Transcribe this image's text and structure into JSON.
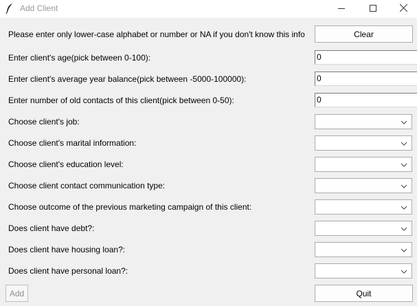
{
  "window": {
    "title": "Add Client",
    "icon": "feather-icon"
  },
  "form": {
    "instruction": "Please enter only lower-case alphabet or number or NA if you don't know this info",
    "clear_label": "Clear",
    "age_label": "Enter client's age(pick between 0-100):",
    "age_value": "0",
    "balance_label": "Enter client's average year balance(pick between -5000-100000):",
    "balance_value": "0",
    "contacts_label": "Enter number of old contacts of this client(pick between 0-50):",
    "contacts_value": "0",
    "job_label": "Choose client's job:",
    "job_value": "",
    "marital_label": "Choose client's marital information:",
    "marital_value": "",
    "education_label": "Choose client's education level:",
    "education_value": "",
    "contact_type_label": "Choose client contact communication type:",
    "contact_type_value": "",
    "outcome_label": "Choose outcome of the previous marketing campaign of this client:",
    "outcome_value": "",
    "debt_label": "Does client have debt?:",
    "debt_value": "",
    "housing_label": "Does client have housing loan?:",
    "housing_value": "",
    "personal_label": "Does client have personal loan?:",
    "personal_value": "",
    "add_label": "Add",
    "quit_label": "Quit"
  }
}
